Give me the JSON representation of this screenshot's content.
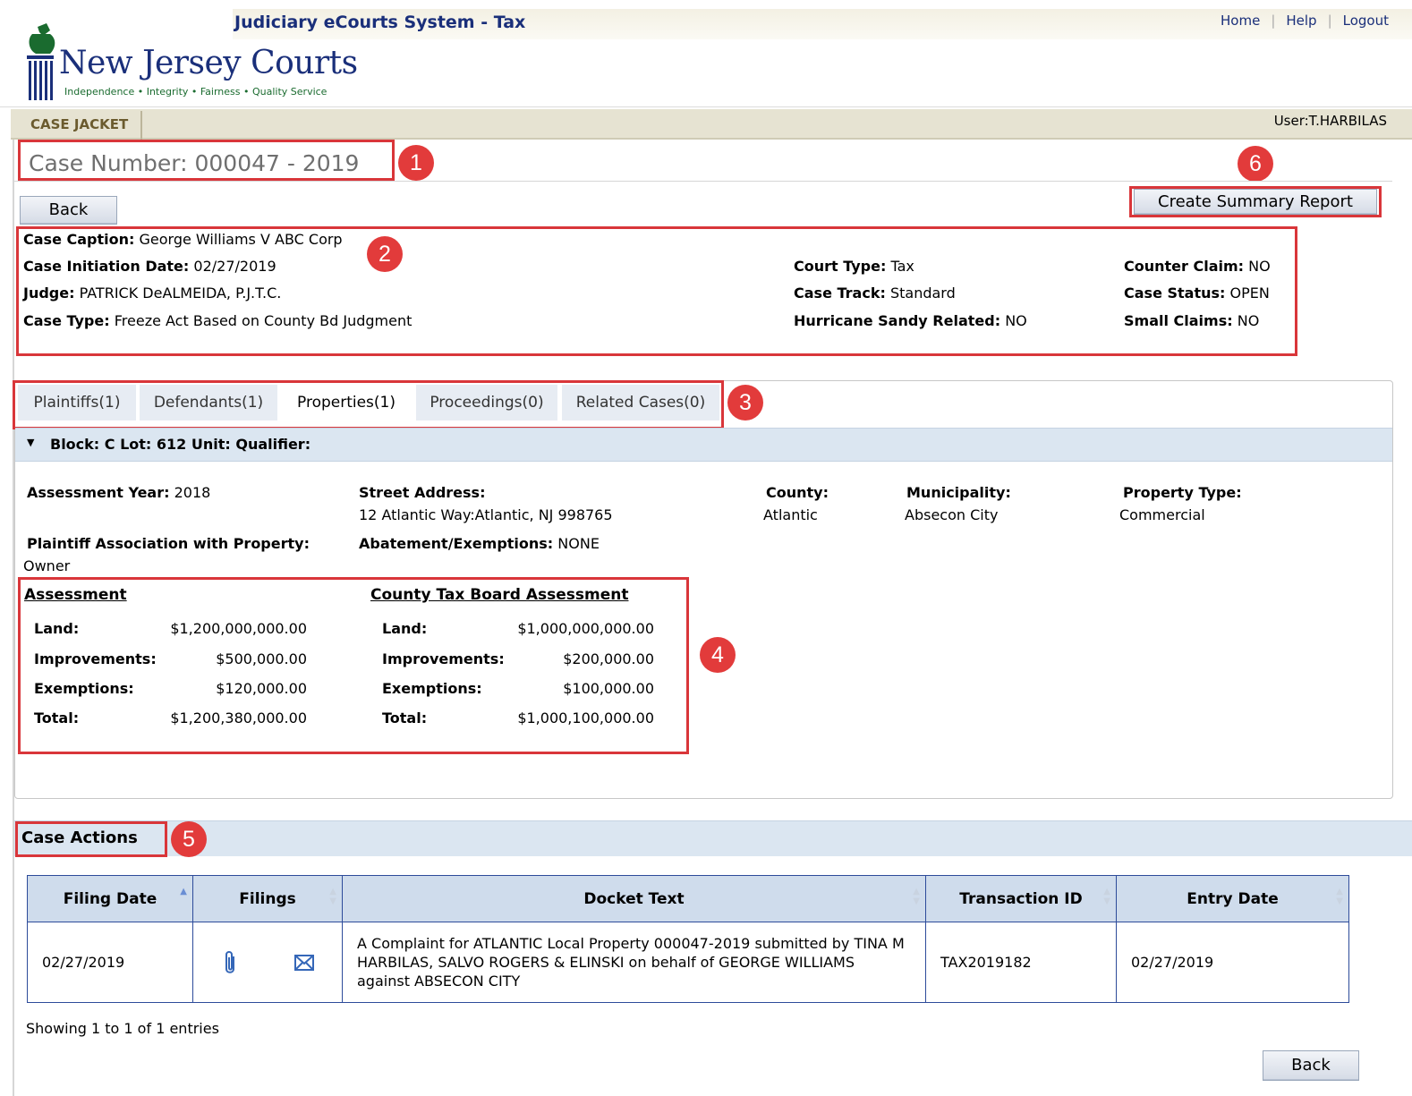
{
  "header": {
    "system_title": "Judiciary eCourts System - Tax",
    "links": [
      "Home",
      "Help",
      "Logout"
    ],
    "logo_name": "New Jersey Courts",
    "logo_tagline": "Independence • Integrity • Fairness • Quality Service"
  },
  "nav": {
    "tab": "CASE JACKET",
    "user": "User:T.HARBILAS"
  },
  "case": {
    "number": "Case Number:  000047 - 2019",
    "back_label": "Back",
    "summary_button": "Create Summary Report",
    "caption_label": "Case Caption:",
    "caption": "George Williams V ABC Corp",
    "initiation_label": "Case Initiation Date:",
    "initiation": "02/27/2019",
    "judge_label": "Judge:",
    "judge": "PATRICK DeALMEIDA, P.J.T.C.",
    "type_label": "Case Type:",
    "type": "Freeze Act  Based on County Bd Judgment",
    "court_type_label": "Court Type:",
    "court_type": "Tax",
    "track_label": "Case Track:",
    "track": "Standard",
    "sandy_label": "Hurricane Sandy Related:",
    "sandy": "NO",
    "counter_label": "Counter Claim:",
    "counter": "NO",
    "status_label": "Case Status:",
    "status": "OPEN",
    "small_label": "Small Claims:",
    "small": "NO"
  },
  "tabs": [
    "Plaintiffs(1)",
    "Defendants(1)",
    "Properties(1)",
    "Proceedings(0)",
    "Related Cases(0)"
  ],
  "property": {
    "block_line": "Block: C  Lot: 612  Unit:  Qualifier:",
    "year_label": "Assessment Year:",
    "year": "2018",
    "street_label": "Street Address:",
    "street": "12 Atlantic Way:Atlantic, NJ 998765",
    "county_label": "County:",
    "county": "Atlantic",
    "muni_label": "Municipality:",
    "muni": "Absecon City",
    "ptype_label": "Property Type:",
    "ptype": "Commercial",
    "assoc_label": "Plaintiff Association with Property:",
    "assoc": "Owner",
    "abate_label": "Abatement/Exemptions:",
    "abate": "NONE"
  },
  "assessment": {
    "title": "Assessment",
    "land_label": "Land:",
    "land": "$1,200,000,000.00",
    "impr_label": "Improvements:",
    "impr": "$500,000.00",
    "exem_label": "Exemptions:",
    "exem": "$120,000.00",
    "total_label": "Total:",
    "total": "$1,200,380,000.00"
  },
  "county_assessment": {
    "title": "County Tax Board Assessment",
    "land_label": "Land:",
    "land": "$1,000,000,000.00",
    "impr_label": "Improvements:",
    "impr": "$200,000.00",
    "exem_label": "Exemptions:",
    "exem": "$100,000.00",
    "total_label": "Total:",
    "total": "$1,000,100,000.00"
  },
  "actions": {
    "title": "Case Actions",
    "columns": [
      "Filing Date",
      "Filings",
      "Docket Text",
      "Transaction ID",
      "Entry Date"
    ],
    "rows": [
      {
        "filing_date": "02/27/2019",
        "docket_text": "A Complaint for ATLANTIC Local Property 000047-2019 submitted by TINA M HARBILAS, SALVO ROGERS & ELINSKI on behalf of GEORGE WILLIAMS against ABSECON CITY",
        "transaction_id": "TAX2019182",
        "entry_date": "02/27/2019"
      }
    ],
    "showing": "Showing 1 to 1 of 1 entries",
    "back_label": "Back"
  },
  "callouts": [
    "1",
    "2",
    "3",
    "4",
    "5",
    "6"
  ],
  "colors": {
    "highlight": "#d9363a",
    "badge": "#e23b3b",
    "brand": "#1a2f7a"
  }
}
